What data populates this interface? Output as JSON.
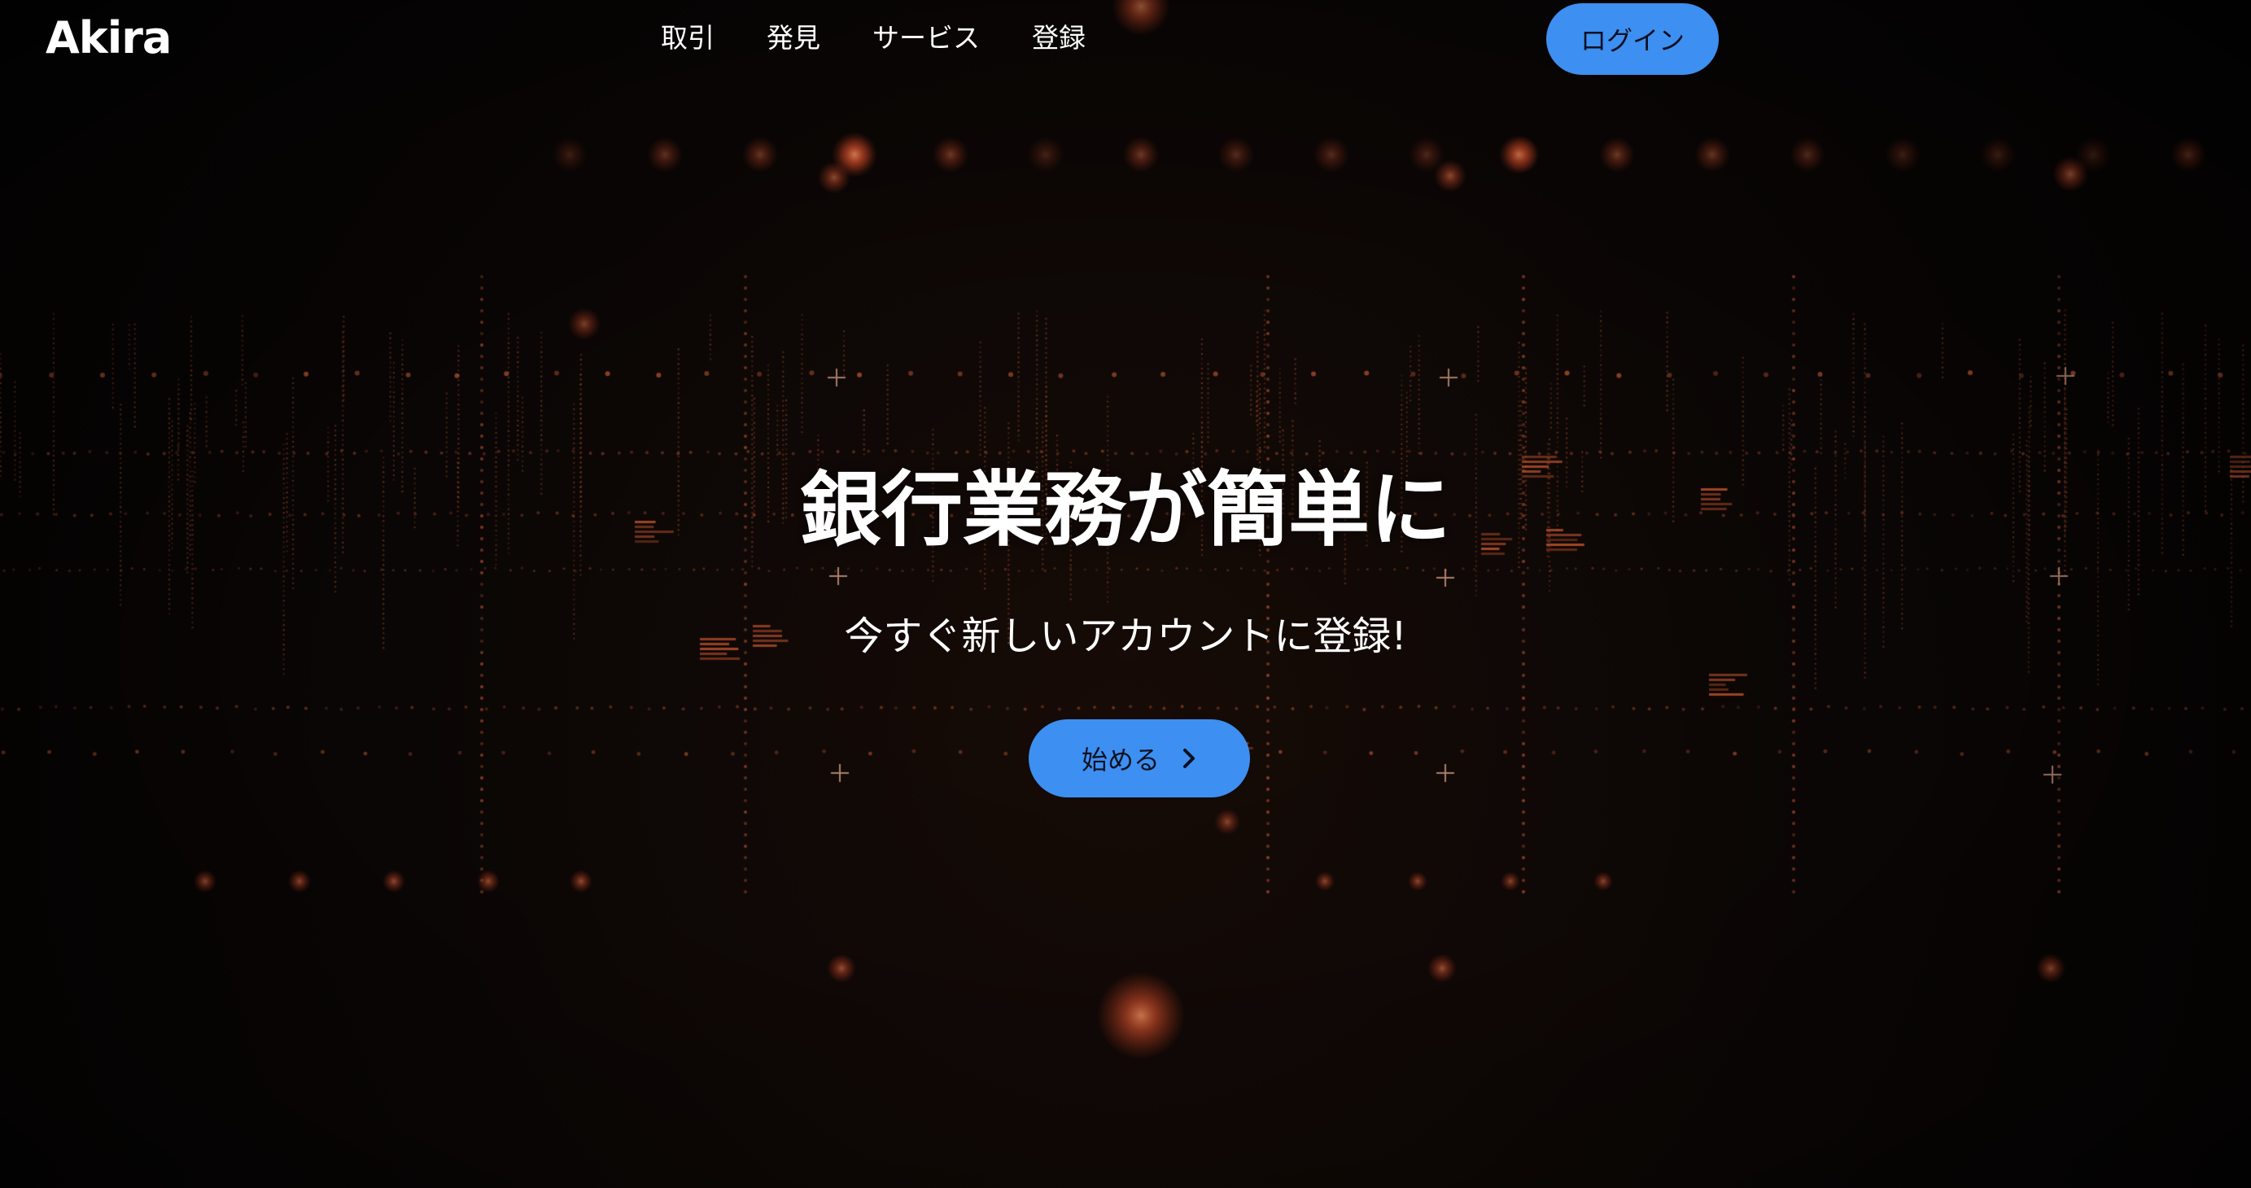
{
  "header": {
    "brand": "Akira",
    "nav": [
      "取引",
      "発見",
      "サービス",
      "登録"
    ],
    "login_label": "ログイン"
  },
  "hero": {
    "title": "銀行業務が簡単に",
    "subtitle": "今すぐ新しいアカウントに登録!",
    "cta_label": "始める",
    "cta_icon": "chevron-right-icon"
  },
  "colors": {
    "background": "#050404",
    "accent": "#3d8ff1",
    "particle": "#ff6a3a"
  }
}
